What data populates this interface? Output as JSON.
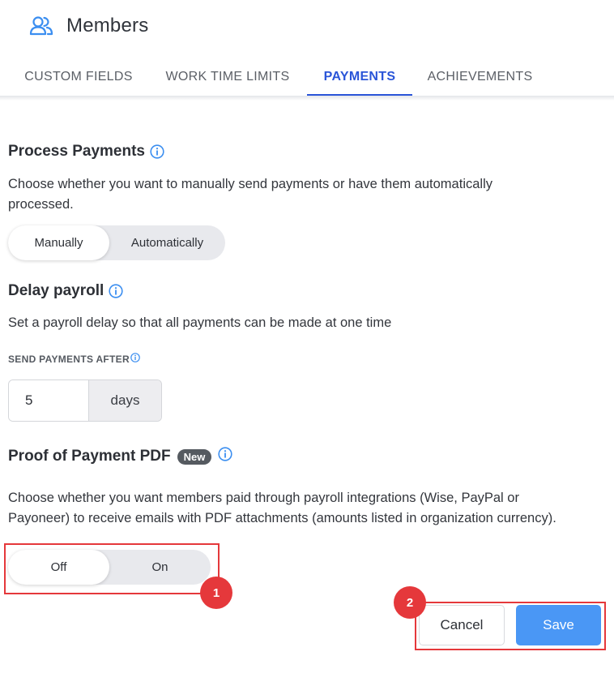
{
  "header": {
    "title": "Members",
    "icon": "members-icon",
    "tabs": [
      {
        "label": "CUSTOM FIELDS",
        "active": false
      },
      {
        "label": "WORK TIME LIMITS",
        "active": false
      },
      {
        "label": "PAYMENTS",
        "active": true
      },
      {
        "label": "ACHIEVEMENTS",
        "active": false
      }
    ]
  },
  "process_payments": {
    "title": "Process Payments",
    "description_line1": "Choose whether you want to manually send payments or have them automatically",
    "description_line2": "processed.",
    "options": [
      "Manually",
      "Automatically"
    ],
    "selected": "Manually"
  },
  "delay_payroll": {
    "title": "Delay payroll",
    "description": "Set a payroll delay so that all payments can be made at one time",
    "field_label": "SEND PAYMENTS AFTER",
    "value": "5",
    "unit": "days"
  },
  "proof_pdf": {
    "title": "Proof of Payment PDF",
    "badge": "New",
    "description_line1": "Choose whether you want members paid through payroll integrations (Wise, PayPal or",
    "description_line2": "Payoneer) to receive emails with PDF attachments (amounts listed in organization currency).",
    "options": [
      "Off",
      "On"
    ],
    "selected": "Off"
  },
  "annotations": {
    "marker1": "1",
    "marker2": "2"
  },
  "actions": {
    "cancel": "Cancel",
    "save": "Save"
  },
  "colors": {
    "accent": "#2a55d8",
    "save_button": "#4a97f5",
    "highlight": "#e5383b",
    "info_icon": "#3b8ef0"
  }
}
